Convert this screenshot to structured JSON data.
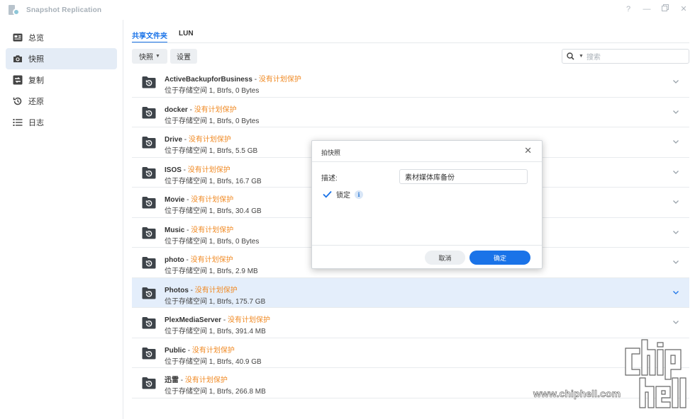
{
  "window": {
    "title": "Snapshot Replication",
    "controls": [
      "?",
      "—",
      "restore",
      "✕"
    ]
  },
  "sidebar": {
    "items": [
      {
        "label": "总览",
        "icon": "overview-icon"
      },
      {
        "label": "快照",
        "icon": "camera-icon",
        "active": true
      },
      {
        "label": "复制",
        "icon": "replication-icon"
      },
      {
        "label": "还原",
        "icon": "restore-icon"
      },
      {
        "label": "日志",
        "icon": "log-list-icon"
      }
    ]
  },
  "tabs": [
    {
      "label": "共享文件夹",
      "active": true
    },
    {
      "label": "LUN",
      "active": false
    }
  ],
  "toolbar": {
    "snapshot_label": "快照",
    "settings_label": "设置",
    "search_placeholder": "搜索"
  },
  "rows": [
    {
      "name": "ActiveBackupforBusiness",
      "sep": " - ",
      "status": "没有计划保护",
      "info": "位于存储空间 1, Btrfs, 0 Bytes"
    },
    {
      "name": "docker",
      "sep": " - ",
      "status": "没有计划保护",
      "info": "位于存储空间 1, Btrfs, 0 Bytes"
    },
    {
      "name": "Drive",
      "sep": " - ",
      "status": "没有计划保护",
      "info": "位于存储空间 1, Btrfs, 5.5 GB"
    },
    {
      "name": "ISOS",
      "sep": " - ",
      "status": "没有计划保护",
      "info": "位于存储空间 1, Btrfs, 16.7 GB"
    },
    {
      "name": "Movie",
      "sep": " - ",
      "status": "没有计划保护",
      "info": "位于存储空间 1, Btrfs, 30.4 GB"
    },
    {
      "name": "Music",
      "sep": " - ",
      "status": "没有计划保护",
      "info": "位于存储空间 1, Btrfs, 0 Bytes"
    },
    {
      "name": "photo",
      "sep": " - ",
      "status": "没有计划保护",
      "info": "位于存储空间 1, Btrfs, 2.9 MB"
    },
    {
      "name": "Photos",
      "sep": " - ",
      "status": "没有计划保护",
      "info": "位于存储空间 1, Btrfs, 175.7 GB",
      "selected": true
    },
    {
      "name": "PlexMediaServer",
      "sep": " - ",
      "status": "没有计划保护",
      "info": "位于存储空间 1, Btrfs, 391.4 MB"
    },
    {
      "name": "Public",
      "sep": " - ",
      "status": "没有计划保护",
      "info": "位于存储空间 1, Btrfs, 40.9 GB"
    },
    {
      "name": "迅雷",
      "sep": " - ",
      "status": "没有计划保护",
      "info": "位于存储空间 1, Btrfs, 266.8 MB"
    }
  ],
  "dialog": {
    "title": "拍快照",
    "desc_label": "描述:",
    "desc_value": "素材媒体库备份",
    "lock_label": "锁定",
    "lock_checked": true,
    "info_glyph": "i",
    "cancel_label": "取消",
    "ok_label": "确定"
  },
  "watermark": {
    "text": "www.chiphell.com",
    "logo_text": "chip hell"
  },
  "colors": {
    "accent": "#1a73e8",
    "warning": "#f08a24",
    "selected_row": "#e4eefb",
    "sidebar_active": "#e4ecf6"
  }
}
